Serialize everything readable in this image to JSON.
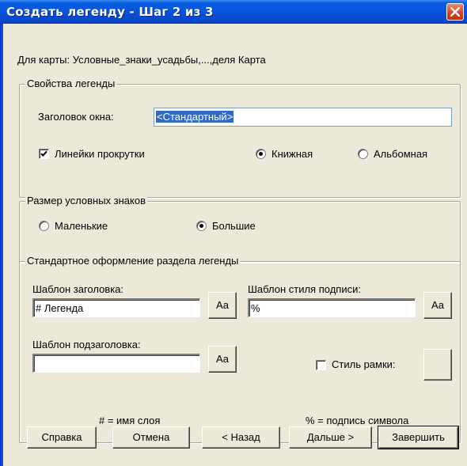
{
  "window": {
    "title": "Создать легенду - Шаг 2 из 3",
    "subtitle": "Для карты: Условные_знаки_усадьбы,...,деля Карта"
  },
  "legend_props": {
    "group_label": "Свойства легенды",
    "window_title_label": "Заголовок окна:",
    "window_title_value": "<Стандартный>",
    "scrollbars_label": "Линейки прокрутки",
    "scrollbars_checked": true,
    "portrait_label": "Книжная",
    "landscape_label": "Альбомная",
    "orientation_selected": "portrait"
  },
  "symbol_size": {
    "group_label": "Размер условных знаков",
    "small_label": "Маленькие",
    "large_label": "Большие",
    "selected": "large"
  },
  "section_style": {
    "group_label": "Стандартное оформление раздела легенды",
    "heading_template_label": "Шаблон заголовка:",
    "heading_template_value": "# Легенда",
    "caption_template_label": "Шаблон стиля подписи:",
    "caption_template_value": "%",
    "subheading_template_label": "Шаблон подзаголовка:",
    "subheading_template_value": "",
    "font_button_label": "Aa",
    "frame_style_label": "Стиль рамки:",
    "frame_style_checked": false,
    "hash_note": "# = имя слоя",
    "percent_note": "% = подпись символа"
  },
  "buttons": {
    "help": "Справка",
    "cancel": "Отмена",
    "back": "< Назад",
    "next": "Дальше >",
    "finish": "Завершить"
  }
}
